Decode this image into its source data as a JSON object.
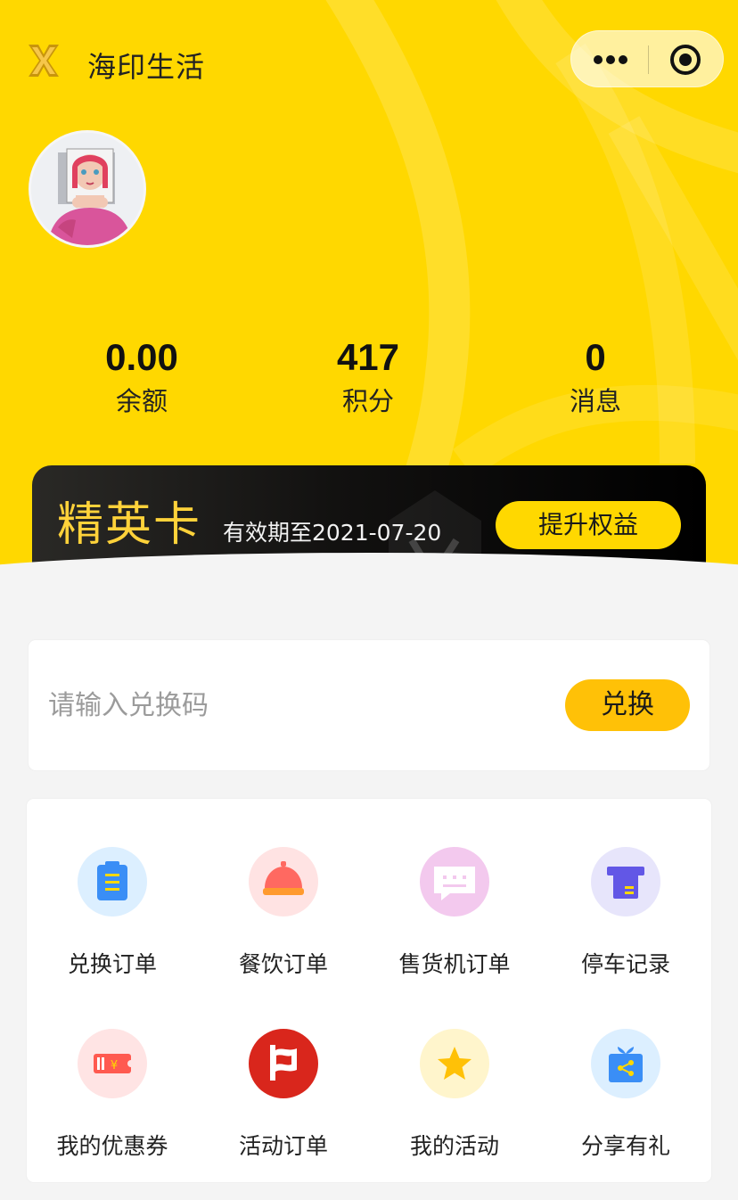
{
  "header": {
    "app_title": "海印生活",
    "logo_icon": "app-logo-icon",
    "capsule": {
      "more_icon": "more-dots-icon",
      "close_icon": "target-circle-icon"
    }
  },
  "stats": [
    {
      "value": "0.00",
      "label": "余额"
    },
    {
      "value": "417",
      "label": "积分"
    },
    {
      "value": "0",
      "label": "消息"
    }
  ],
  "member_card": {
    "name": "精英卡",
    "validity": "有效期至2021-07-20",
    "upgrade_label": "提升权益"
  },
  "redeem": {
    "placeholder": "请输入兑换码",
    "button_label": "兑换"
  },
  "menu": [
    {
      "label": "兑换订单",
      "icon": "clipboard-icon",
      "bg": "#dcefff"
    },
    {
      "label": "餐饮订单",
      "icon": "service-bell-icon",
      "bg": "#ffe3e3"
    },
    {
      "label": "售货机订单",
      "icon": "chat-bubble-icon",
      "bg": "#f3c9ee"
    },
    {
      "label": "停车记录",
      "icon": "parking-ticket-icon",
      "bg": "#e7e5fb"
    },
    {
      "label": "我的优惠券",
      "icon": "coupon-icon",
      "bg": "#ffe4e4"
    },
    {
      "label": "活动订单",
      "icon": "flag-icon",
      "bg": "#d9261c"
    },
    {
      "label": "我的活动",
      "icon": "star-icon",
      "bg": "#fff5cc"
    },
    {
      "label": "分享有礼",
      "icon": "gift-share-icon",
      "bg": "#dcefff"
    }
  ],
  "colors": {
    "brand_yellow": "#ffd800",
    "button_yellow": "#ffc107",
    "card_gold": "#ffd23a"
  }
}
